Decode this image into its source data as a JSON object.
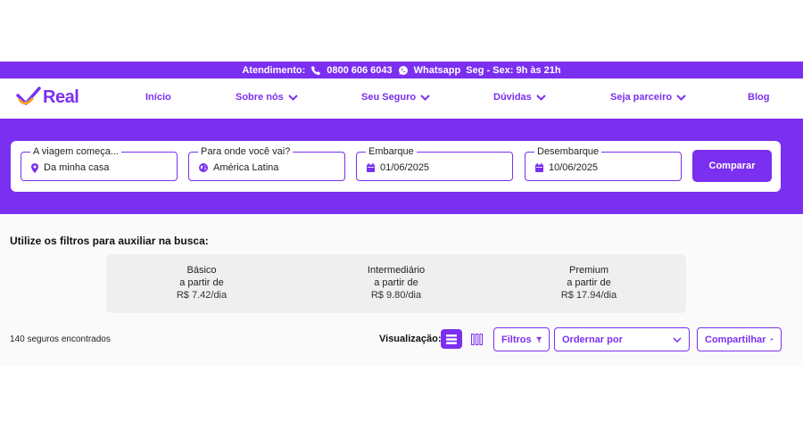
{
  "topbar": {
    "atendimento_label": "Atendimento:",
    "phone": "0800 606 6043",
    "whatsapp": "Whatsapp",
    "hours": "Seg - Sex: 9h às 21h"
  },
  "header": {
    "logo_text": "Real",
    "nav": [
      {
        "label": "Início",
        "icon": ""
      },
      {
        "label": "Sobre nós",
        "icon": "chevron-down-icon"
      },
      {
        "label": "Seu Seguro",
        "icon": "chevron-down-icon"
      },
      {
        "label": "Dúvidas",
        "icon": "chevron-down-icon"
      },
      {
        "label": "Seja parceiro",
        "icon": "chevron-down-icon"
      },
      {
        "label": "Blog",
        "icon": ""
      }
    ]
  },
  "search": {
    "origin": {
      "label": "A viagem começa...",
      "value": "Da minha casa",
      "icon": "location-pin-icon"
    },
    "destination": {
      "label": "Para onde você vai?",
      "value": "América Latina",
      "icon": "globe-icon"
    },
    "departure": {
      "label": "Embarque",
      "value": "01/06/2025",
      "icon": "calendar-icon"
    },
    "return": {
      "label": "Desembarque",
      "value": "10/06/2025",
      "icon": "calendar-icon"
    },
    "compare_label": "Comparar"
  },
  "filters": {
    "title": "Utilize os filtros para auxiliar na busca:",
    "plans": [
      {
        "name": "Básico",
        "from": "a partir de",
        "price": "R$ 7.42/dia"
      },
      {
        "name": "Intermediário",
        "from": "a partir de",
        "price": "R$ 9.80/dia"
      },
      {
        "name": "Premium",
        "from": "a partir de",
        "price": "R$ 17.94/dia"
      }
    ]
  },
  "results": {
    "count_text": "140 seguros encontrados",
    "view_label": "Visualização:",
    "filters_button": "Filtros",
    "sort_placeholder": "Ordernar por",
    "share_button": "Compartilhar"
  },
  "colors": {
    "accent": "#7b2ff0",
    "plans_bg": "#efefef",
    "content_bg": "#fafafa"
  }
}
